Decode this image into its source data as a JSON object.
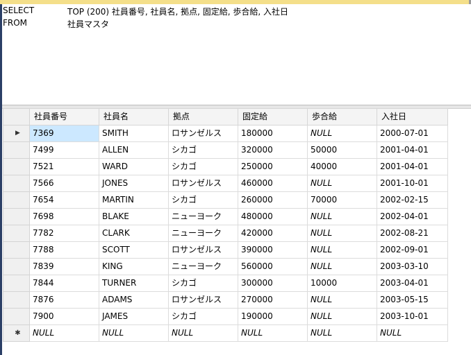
{
  "query": {
    "line1": {
      "keyword": "SELECT",
      "body": "TOP (200) 社員番号, 社員名, 拠点, 固定給, 歩合給, 入社日"
    },
    "line2": {
      "keyword": "FROM",
      "body": "社員マスタ"
    }
  },
  "grid": {
    "columns": [
      "社員番号",
      "社員名",
      "拠点",
      "固定給",
      "歩合給",
      "入社日"
    ],
    "rows": [
      [
        "7369",
        "SMITH",
        "ロサンゼルス",
        "180000",
        "NULL",
        "2000-07-01"
      ],
      [
        "7499",
        "ALLEN",
        "シカゴ",
        "320000",
        "50000",
        "2001-04-01"
      ],
      [
        "7521",
        "WARD",
        "シカゴ",
        "250000",
        "40000",
        "2001-04-01"
      ],
      [
        "7566",
        "JONES",
        "ロサンゼルス",
        "460000",
        "NULL",
        "2001-10-01"
      ],
      [
        "7654",
        "MARTIN",
        "シカゴ",
        "260000",
        "70000",
        "2002-02-15"
      ],
      [
        "7698",
        "BLAKE",
        "ニューヨーク",
        "480000",
        "NULL",
        "2002-04-01"
      ],
      [
        "7782",
        "CLARK",
        "ニューヨーク",
        "420000",
        "NULL",
        "2002-08-21"
      ],
      [
        "7788",
        "SCOTT",
        "ロサンゼルス",
        "390000",
        "NULL",
        "2002-09-01"
      ],
      [
        "7839",
        "KING",
        "ニューヨーク",
        "560000",
        "NULL",
        "2003-03-10"
      ],
      [
        "7844",
        "TURNER",
        "シカゴ",
        "300000",
        "10000",
        "2003-04-01"
      ],
      [
        "7876",
        "ADAMS",
        "ロサンゼルス",
        "270000",
        "NULL",
        "2003-05-15"
      ],
      [
        "7900",
        "JAMES",
        "シカゴ",
        "190000",
        "NULL",
        "2003-10-01"
      ]
    ],
    "new_row": [
      "NULL",
      "NULL",
      "NULL",
      "NULL",
      "NULL",
      "NULL"
    ],
    "current_row_marker": "▶",
    "new_row_marker": "✱",
    "colors": {
      "selected_cell": "#cce8ff",
      "header_bg": "#f4f4f4"
    }
  }
}
